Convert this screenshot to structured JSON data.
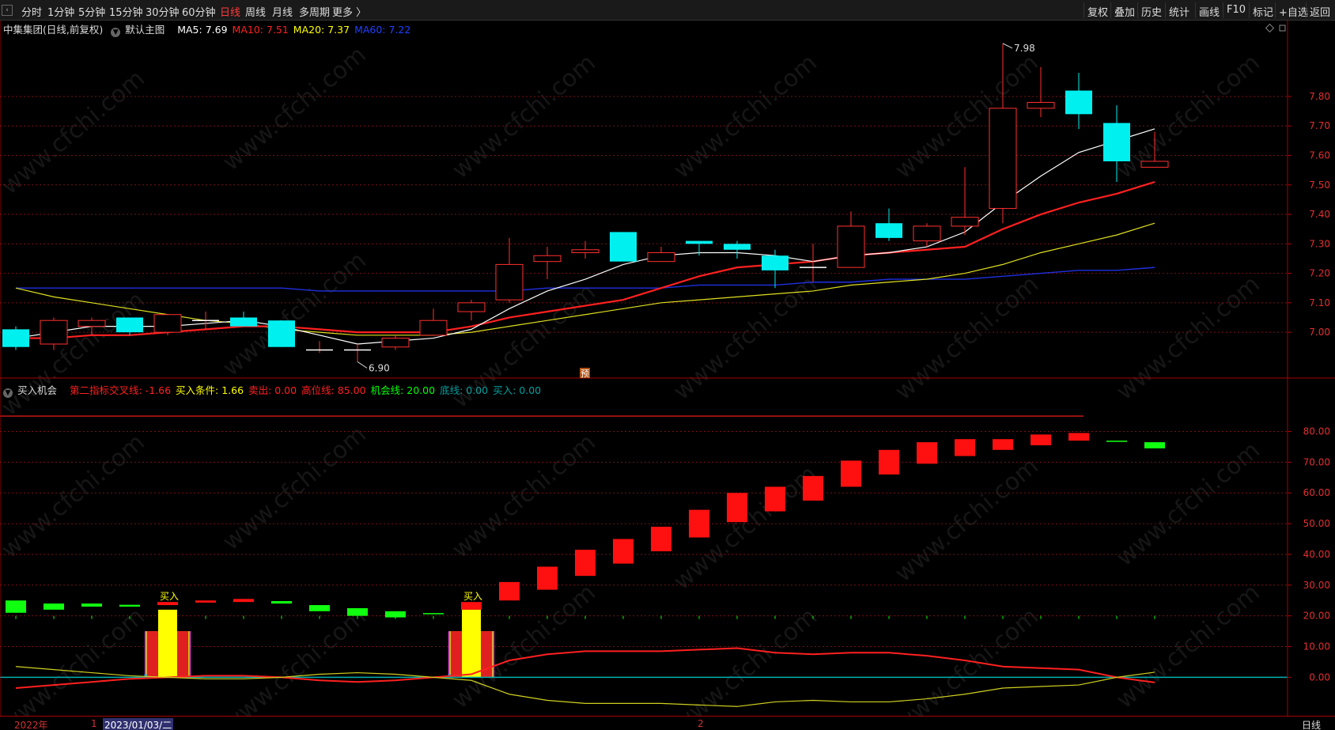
{
  "toolbar": {
    "periods": [
      {
        "label": "分时",
        "active": false
      },
      {
        "label": "1分钟",
        "active": false
      },
      {
        "label": "5分钟",
        "active": false
      },
      {
        "label": "15分钟",
        "active": false
      },
      {
        "label": "30分钟",
        "active": false
      },
      {
        "label": "60分钟",
        "active": false
      },
      {
        "label": "日线",
        "active": true
      },
      {
        "label": "周线",
        "active": false
      },
      {
        "label": "月线",
        "active": false
      },
      {
        "label": "多周期",
        "active": false
      },
      {
        "label": "更多 〉",
        "active": false
      }
    ],
    "right_buttons": [
      "复权",
      "叠加",
      "历史",
      "统计",
      "画线",
      "F10",
      "标记",
      "+自选",
      "返回"
    ]
  },
  "main_legend": {
    "stock": "中集集团(日线,前复权)",
    "template": "默认主图",
    "ma": [
      {
        "label": "MA5: 7.69",
        "color": "#ffffff"
      },
      {
        "label": "MA10: 7.51",
        "color": "#ff2020"
      },
      {
        "label": "MA20: 7.37",
        "color": "#ffff00"
      },
      {
        "label": "MA60: 7.22",
        "color": "#2040ff"
      }
    ]
  },
  "sub_legend": {
    "name": "买入机会",
    "items": [
      {
        "label": "第二指标交叉线: -1.66",
        "color": "#ff2020"
      },
      {
        "label": "买入条件: 1.66",
        "color": "#ffff00"
      },
      {
        "label": "卖出: 0.00",
        "color": "#ff2020"
      },
      {
        "label": "高位线: 85.00",
        "color": "#ff2020"
      },
      {
        "label": "机会线: 20.00",
        "color": "#00ff00"
      },
      {
        "label": "底线: 0.00",
        "color": "#00a0a0"
      },
      {
        "label": "买入: 0.00",
        "color": "#00a0a0"
      }
    ]
  },
  "chart_data": [
    {
      "type": "candlestick",
      "title": "中集集团(日线,前复权)",
      "y_ticks": [
        "7.80",
        "7.70",
        "7.60",
        "7.50",
        "7.40",
        "7.30",
        "7.20",
        "7.10",
        "7.00"
      ],
      "ylim": [
        6.85,
        8.02
      ],
      "candles": [
        {
          "o": 7.01,
          "h": 7.02,
          "l": 6.94,
          "c": 6.95
        },
        {
          "o": 6.96,
          "h": 7.05,
          "l": 6.94,
          "c": 7.04
        },
        {
          "o": 7.02,
          "h": 7.05,
          "l": 6.99,
          "c": 7.04
        },
        {
          "o": 7.05,
          "h": 7.05,
          "l": 6.99,
          "c": 7.0
        },
        {
          "o": 7.0,
          "h": 7.06,
          "l": 6.99,
          "c": 7.06
        },
        {
          "o": 7.04,
          "h": 7.07,
          "l": 7.01,
          "c": 7.04
        },
        {
          "o": 7.05,
          "h": 7.07,
          "l": 7.02,
          "c": 7.02
        },
        {
          "o": 7.04,
          "h": 7.04,
          "l": 6.95,
          "c": 6.95
        },
        {
          "o": 6.94,
          "h": 6.97,
          "l": 6.93,
          "c": 6.94
        },
        {
          "o": 6.94,
          "h": 6.96,
          "l": 6.9,
          "c": 6.94
        },
        {
          "o": 6.95,
          "h": 6.99,
          "l": 6.94,
          "c": 6.98
        },
        {
          "o": 6.99,
          "h": 7.08,
          "l": 6.99,
          "c": 7.04
        },
        {
          "o": 7.07,
          "h": 7.11,
          "l": 7.04,
          "c": 7.1
        },
        {
          "o": 7.11,
          "h": 7.32,
          "l": 7.1,
          "c": 7.23
        },
        {
          "o": 7.24,
          "h": 7.29,
          "l": 7.18,
          "c": 7.26
        },
        {
          "o": 7.27,
          "h": 7.31,
          "l": 7.25,
          "c": 7.28
        },
        {
          "o": 7.34,
          "h": 7.34,
          "l": 7.24,
          "c": 7.24
        },
        {
          "o": 7.24,
          "h": 7.29,
          "l": 7.24,
          "c": 7.27
        },
        {
          "o": 7.31,
          "h": 7.31,
          "l": 7.26,
          "c": 7.3
        },
        {
          "o": 7.3,
          "h": 7.31,
          "l": 7.25,
          "c": 7.28
        },
        {
          "o": 7.26,
          "h": 7.28,
          "l": 7.15,
          "c": 7.21
        },
        {
          "o": 7.22,
          "h": 7.3,
          "l": 7.17,
          "c": 7.22
        },
        {
          "o": 7.22,
          "h": 7.41,
          "l": 7.22,
          "c": 7.36
        },
        {
          "o": 7.37,
          "h": 7.42,
          "l": 7.31,
          "c": 7.32
        },
        {
          "o": 7.31,
          "h": 7.37,
          "l": 7.29,
          "c": 7.36
        },
        {
          "o": 7.36,
          "h": 7.56,
          "l": 7.33,
          "c": 7.39
        },
        {
          "o": 7.42,
          "h": 7.98,
          "l": 7.37,
          "c": 7.76
        },
        {
          "o": 7.76,
          "h": 7.9,
          "l": 7.73,
          "c": 7.78
        },
        {
          "o": 7.82,
          "h": 7.88,
          "l": 7.69,
          "c": 7.74
        },
        {
          "o": 7.71,
          "h": 7.77,
          "l": 7.51,
          "c": 7.58
        },
        {
          "o": 7.56,
          "h": 7.68,
          "l": 7.56,
          "c": 7.58
        }
      ],
      "ma5": [
        6.98,
        7.0,
        7.02,
        7.02,
        7.02,
        7.03,
        7.04,
        7.02,
        6.99,
        6.96,
        6.97,
        6.98,
        7.01,
        7.08,
        7.14,
        7.18,
        7.23,
        7.26,
        7.27,
        7.27,
        7.26,
        7.24,
        7.26,
        7.27,
        7.29,
        7.34,
        7.44,
        7.53,
        7.61,
        7.65,
        7.69
      ],
      "ma10": [
        6.98,
        6.98,
        6.99,
        6.99,
        7.0,
        7.01,
        7.02,
        7.02,
        7.01,
        7.0,
        7.0,
        7.0,
        7.02,
        7.05,
        7.07,
        7.09,
        7.11,
        7.15,
        7.19,
        7.22,
        7.23,
        7.24,
        7.26,
        7.27,
        7.28,
        7.29,
        7.35,
        7.4,
        7.44,
        7.47,
        7.51
      ],
      "ma20": [
        7.15,
        7.12,
        7.1,
        7.08,
        7.06,
        7.04,
        7.03,
        7.01,
        7.0,
        6.99,
        6.99,
        6.99,
        7.0,
        7.02,
        7.04,
        7.06,
        7.08,
        7.1,
        7.11,
        7.12,
        7.13,
        7.14,
        7.16,
        7.17,
        7.18,
        7.2,
        7.23,
        7.27,
        7.3,
        7.33,
        7.37
      ],
      "ma60": [
        7.15,
        7.15,
        7.15,
        7.15,
        7.15,
        7.15,
        7.15,
        7.15,
        7.14,
        7.14,
        7.14,
        7.14,
        7.14,
        7.14,
        7.15,
        7.15,
        7.15,
        7.15,
        7.16,
        7.16,
        7.16,
        7.17,
        7.17,
        7.18,
        7.18,
        7.18,
        7.19,
        7.2,
        7.21,
        7.21,
        7.22
      ],
      "annotations": [
        "7.98",
        "6.90",
        "预"
      ]
    },
    {
      "type": "bar",
      "title": "买入机会",
      "y_ticks": [
        "80.00",
        "70.00",
        "60.00",
        "50.00",
        "40.00",
        "30.00",
        "20.00",
        "10.00",
        "0.00"
      ],
      "ylim": [
        -12,
        93
      ],
      "high_line": 85.0,
      "chance_line": 20.0,
      "bars": [
        {
          "lo": 21.0,
          "hi": 25.0,
          "color": "green"
        },
        {
          "lo": 22.0,
          "hi": 24.0,
          "color": "green"
        },
        {
          "lo": 23.0,
          "hi": 24.0,
          "color": "green"
        },
        {
          "lo": 23.0,
          "hi": 23.6,
          "color": "green"
        },
        {
          "lo": 23.5,
          "hi": 24.5,
          "color": "red"
        },
        {
          "lo": 24.3,
          "hi": 25.0,
          "color": "red"
        },
        {
          "lo": 24.5,
          "hi": 25.5,
          "color": "red"
        },
        {
          "lo": 24.0,
          "hi": 24.8,
          "color": "green"
        },
        {
          "lo": 21.5,
          "hi": 23.5,
          "color": "green"
        },
        {
          "lo": 20.0,
          "hi": 22.5,
          "color": "green"
        },
        {
          "lo": 19.5,
          "hi": 21.5,
          "color": "green"
        },
        {
          "lo": 20.5,
          "hi": 20.9,
          "color": "green"
        },
        {
          "lo": 22.0,
          "hi": 24.5,
          "color": "red"
        },
        {
          "lo": 25.0,
          "hi": 31.0,
          "color": "red"
        },
        {
          "lo": 28.5,
          "hi": 36.0,
          "color": "red"
        },
        {
          "lo": 33.0,
          "hi": 41.5,
          "color": "red"
        },
        {
          "lo": 37.0,
          "hi": 45.0,
          "color": "red"
        },
        {
          "lo": 41.0,
          "hi": 49.0,
          "color": "red"
        },
        {
          "lo": 45.5,
          "hi": 54.5,
          "color": "red"
        },
        {
          "lo": 50.5,
          "hi": 60.0,
          "color": "red"
        },
        {
          "lo": 54.0,
          "hi": 62.0,
          "color": "red"
        },
        {
          "lo": 57.5,
          "hi": 65.5,
          "color": "red"
        },
        {
          "lo": 62.0,
          "hi": 70.5,
          "color": "red"
        },
        {
          "lo": 66.0,
          "hi": 74.0,
          "color": "red"
        },
        {
          "lo": 69.5,
          "hi": 76.5,
          "color": "red"
        },
        {
          "lo": 72.0,
          "hi": 77.5,
          "color": "red"
        },
        {
          "lo": 74.0,
          "hi": 77.5,
          "color": "red"
        },
        {
          "lo": 75.5,
          "hi": 79.0,
          "color": "red"
        },
        {
          "lo": 77.0,
          "hi": 79.5,
          "color": "red"
        },
        {
          "lo": 76.6,
          "hi": 77.0,
          "color": "green"
        },
        {
          "lo": 74.5,
          "hi": 76.5,
          "color": "green"
        }
      ],
      "buy_signals": [
        4,
        12
      ],
      "buy_label": "买入",
      "cross_line": [
        -3.5,
        -2.5,
        -1.5,
        -0.5,
        0.0,
        0.5,
        0.5,
        0.0,
        -1.0,
        -1.5,
        -1.0,
        0.0,
        1.0,
        5.5,
        7.5,
        8.5,
        8.5,
        8.5,
        9.0,
        9.5,
        8.0,
        7.5,
        8.0,
        8.0,
        7.0,
        5.5,
        3.5,
        3.0,
        2.5,
        0.0,
        -1.66
      ],
      "buy_cond_line": [
        3.5,
        2.5,
        1.5,
        0.5,
        0.0,
        -0.5,
        -0.5,
        0.0,
        1.0,
        1.5,
        1.0,
        0.0,
        -1.0,
        -5.5,
        -7.5,
        -8.5,
        -8.5,
        -8.5,
        -9.0,
        -9.5,
        -8.0,
        -7.5,
        -8.0,
        -8.0,
        -7.0,
        -5.5,
        -3.5,
        -3.0,
        -2.5,
        0.0,
        1.66
      ]
    }
  ],
  "bottom_bar": {
    "year_label": "2022年",
    "month_mark_1": "1",
    "cursor_date": "2023/01/03/二",
    "month_mark_2": "2",
    "period": "日线"
  },
  "watermark": "www.cfchi.com"
}
